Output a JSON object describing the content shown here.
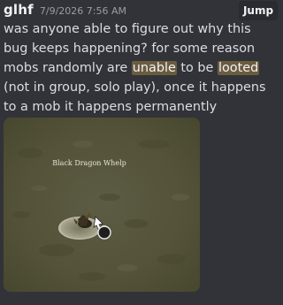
{
  "message": {
    "username": "glhf",
    "timestamp": "7/9/2026 7:56 AM",
    "jump_label": "Jump",
    "text_part1": "was anyone able to figure out why this bug keeps happening? for some reason mobs randomly are ",
    "highlight1": "unable",
    "text_part2": " to be ",
    "highlight2": "looted",
    "text_part3": " (not in group, solo play), once it happens to a mob it happens permanently afterwards."
  },
  "attachment": {
    "mob_nameplate": "Black Dragon Whelp"
  },
  "colors": {
    "background": "#323339",
    "highlight": "#6b5c3f",
    "ground": "#56553f"
  }
}
